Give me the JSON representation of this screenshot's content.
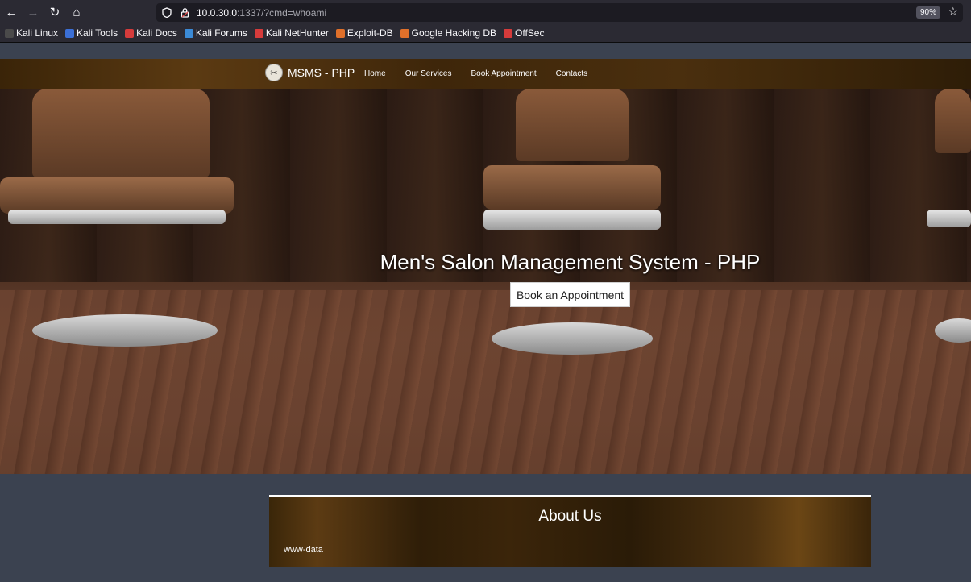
{
  "browser": {
    "url_host": "10.0.30.0",
    "url_rest": ":1337/?cmd=whoami",
    "zoom": "90%",
    "bookmarks": [
      {
        "label": "Kali Linux",
        "color": "#4a4a4a"
      },
      {
        "label": "Kali Tools",
        "color": "#3b6fd6"
      },
      {
        "label": "Kali Docs",
        "color": "#d63b3b"
      },
      {
        "label": "Kali Forums",
        "color": "#3b8ad6"
      },
      {
        "label": "Kali NetHunter",
        "color": "#d63b3b"
      },
      {
        "label": "Exploit-DB",
        "color": "#e0702a"
      },
      {
        "label": "Google Hacking DB",
        "color": "#e0702a"
      },
      {
        "label": "OffSec",
        "color": "#d63b3b"
      }
    ]
  },
  "site": {
    "brand": "MSMS - PHP",
    "nav": [
      "Home",
      "Our Services",
      "Book Appointment",
      "Contacts"
    ],
    "hero_title": "Men's Salon Management System - PHP",
    "hero_button": "Book an Appointment",
    "about_title": "About Us",
    "about_text": "www-data"
  }
}
